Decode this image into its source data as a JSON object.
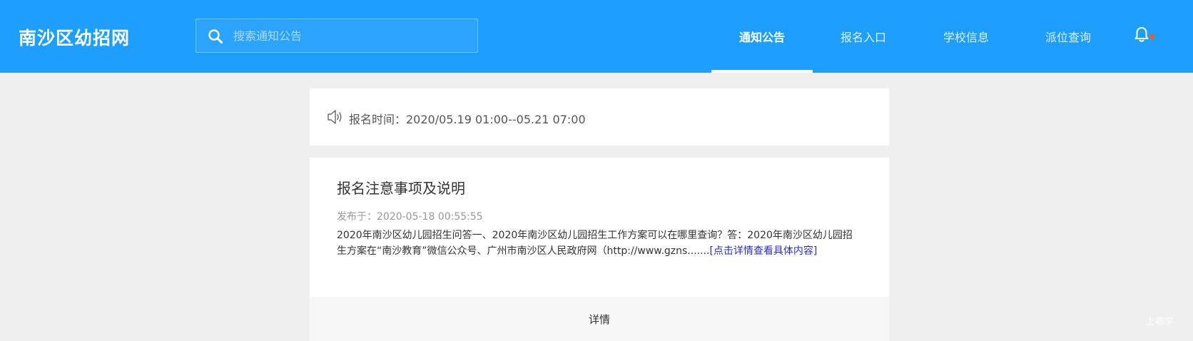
{
  "header": {
    "site_title": "南沙区幼招网",
    "search_placeholder": "搜索通知公告",
    "nav": [
      {
        "label": "通知公告",
        "active": true
      },
      {
        "label": "报名入口",
        "active": false
      },
      {
        "label": "学校信息",
        "active": false
      },
      {
        "label": "派位查询",
        "active": false
      }
    ],
    "notification_indicator_color": "#ff5722"
  },
  "notice": {
    "icon": "speaker-icon",
    "text": "报名时间：2020/05.19 01:00--05.21 07:00"
  },
  "article": {
    "title": "报名注意事项及说明",
    "date": "发布于：2020-05-18 00:55:55",
    "summary": "2020年南沙区幼儿园招生问答一、2020年南沙区幼儿园招生工作方案可以在哪里查询？答：2020年南沙区幼儿园招生方案在“南沙教育”微信公众号、广州市南沙区人民政府网（http://www.gzns.......",
    "more_link": "[点击详情查看具体内容]",
    "footer_button": "详情"
  },
  "watermark": "上哪学",
  "colors": {
    "header_bg": "#1e9fff",
    "page_bg": "#efefef",
    "link": "#2b2bcc"
  }
}
